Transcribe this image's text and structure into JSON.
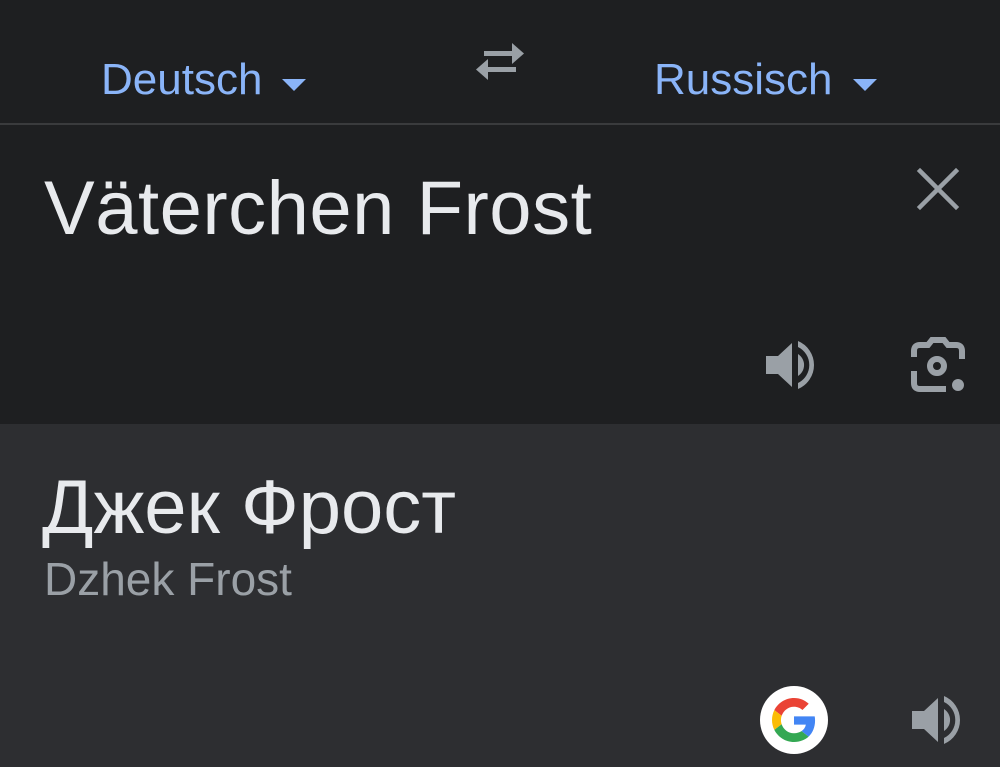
{
  "language_bar": {
    "source_language": "Deutsch",
    "target_language": "Russisch"
  },
  "input": {
    "source_text": "Väterchen Frost"
  },
  "output": {
    "translation": "Джек Фрост",
    "transliteration": "Dzhek Frost"
  },
  "icons": {
    "swap": "swap-arrows-icon",
    "clear": "close-icon",
    "speak_source": "volume-icon",
    "camera": "camera-lens-icon",
    "google": "google-logo-icon",
    "speak_target": "volume-icon"
  },
  "colors": {
    "accent": "#8ab4f8",
    "background_top": "#1e1f21",
    "background_bottom": "#2d2e31",
    "text_primary": "#e8eaed",
    "text_secondary": "#9aa0a6",
    "icon_gray": "#9aa0a6"
  }
}
